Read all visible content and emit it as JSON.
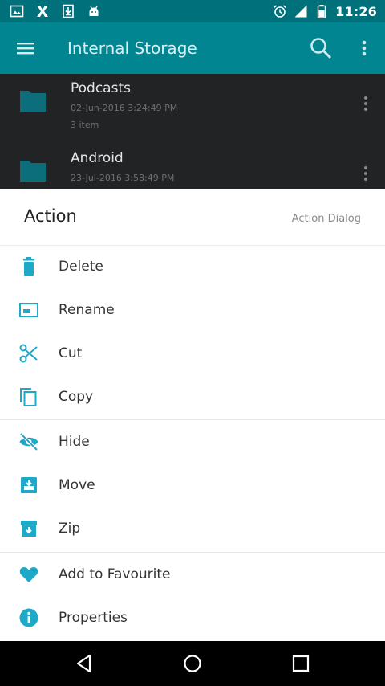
{
  "status_bar": {
    "time": "11:26",
    "left_icons": [
      "image-icon",
      "x-app-icon",
      "download-icon",
      "android-icon"
    ],
    "right_icons": [
      "alarm-icon",
      "signal-icon",
      "battery-icon"
    ]
  },
  "app_bar": {
    "title": "Internal Storage",
    "menu_icon": "menu-icon",
    "search_icon": "search-icon",
    "overflow_icon": "more-vert-icon",
    "color": "#008591"
  },
  "files": [
    {
      "name": "Podcasts",
      "date": "02-Jun-2016 3:24:49 PM",
      "count": "3 item"
    },
    {
      "name": "Android",
      "date": "23-Jul-2016 3:58:49 PM",
      "count": ""
    }
  ],
  "dialog": {
    "title": "Action",
    "subtitle": "Action Dialog",
    "accent_color": "#1fa9c9",
    "actions": [
      {
        "label": "Delete",
        "icon": "trash-icon"
      },
      {
        "label": "Rename",
        "icon": "rename-icon"
      },
      {
        "label": "Cut",
        "icon": "scissors-icon"
      },
      {
        "label": "Copy",
        "icon": "copy-icon"
      },
      {
        "label": "Hide",
        "icon": "eye-off-icon"
      },
      {
        "label": "Move",
        "icon": "move-icon"
      },
      {
        "label": "Zip",
        "icon": "archive-icon"
      },
      {
        "label": "Add to Favourite",
        "icon": "heart-icon"
      },
      {
        "label": "Properties",
        "icon": "info-icon"
      }
    ]
  },
  "nav_bar": {
    "back_icon": "back-icon",
    "home_icon": "home-icon",
    "recents_icon": "recents-icon"
  }
}
